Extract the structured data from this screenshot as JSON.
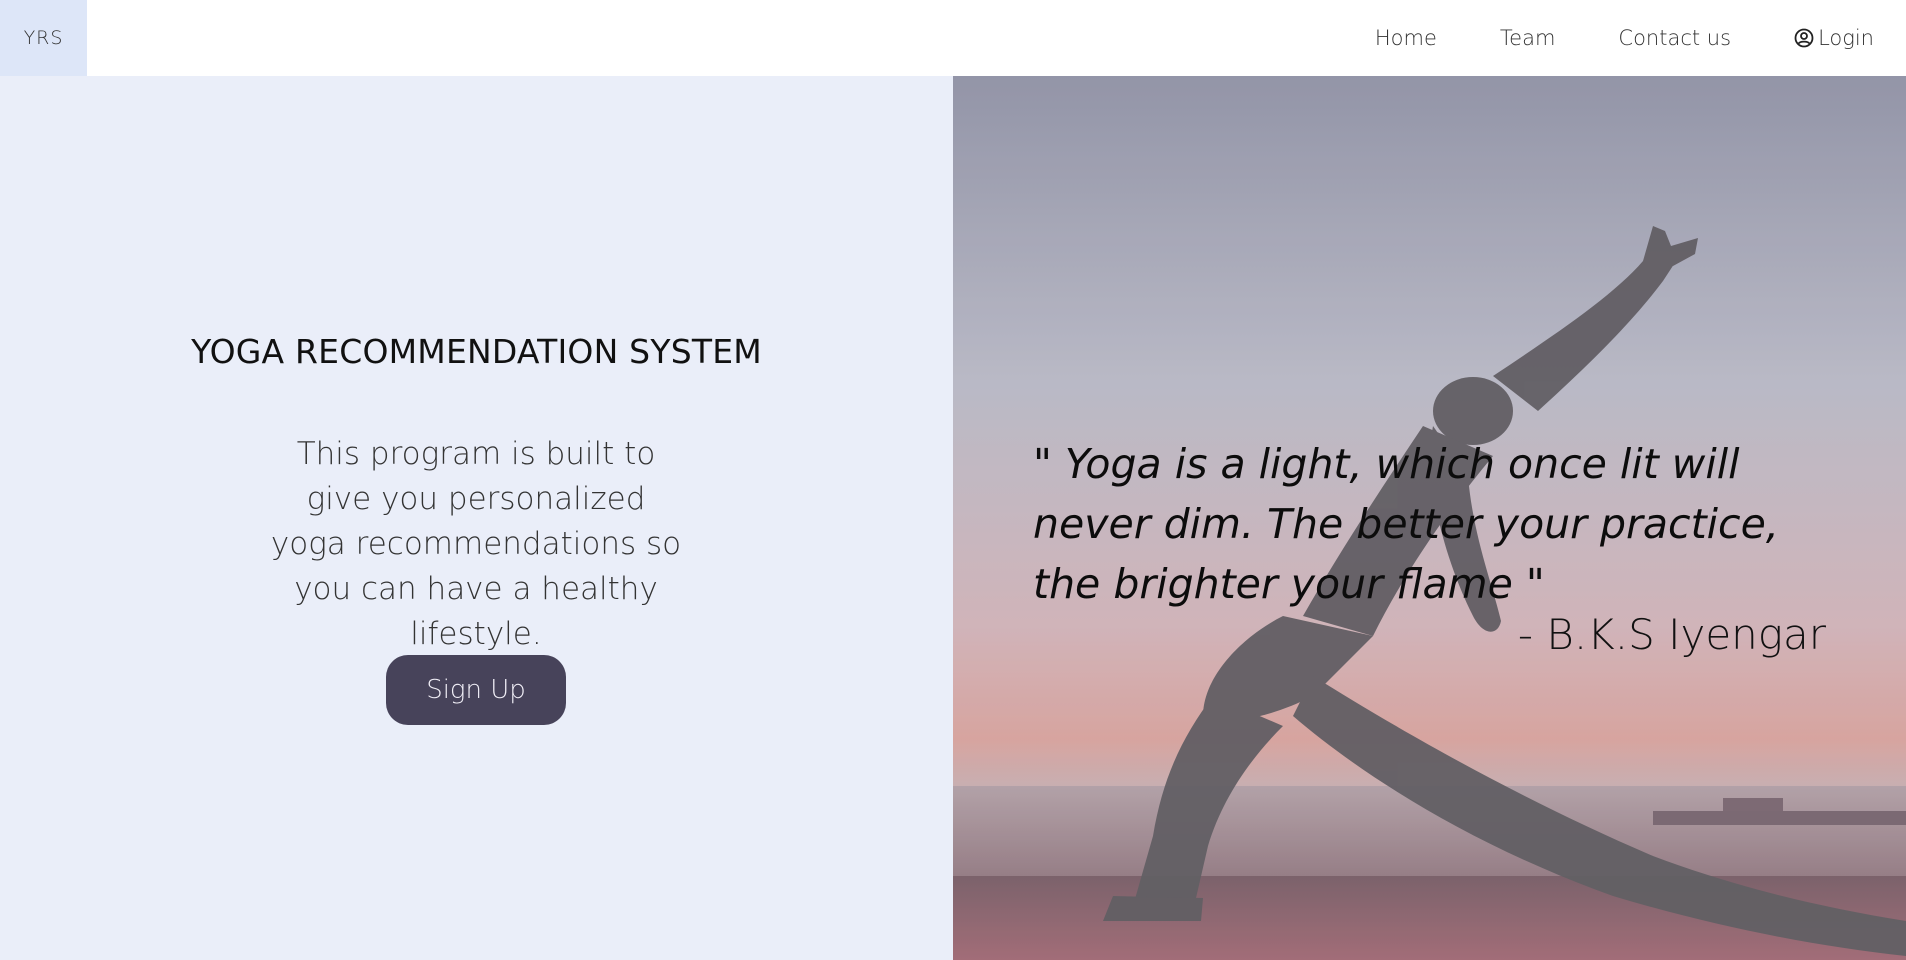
{
  "navbar": {
    "brand": "YRS",
    "links": [
      "Home",
      "Team",
      "Contact us",
      "Login"
    ],
    "login_icon": "user-circle-icon"
  },
  "hero": {
    "title": "YOGA RECOMMENDATION SYSTEM",
    "description": "This program is built to give you personalized yoga recommendations so you can have a healthy lifestyle.",
    "signup_label": "Sign Up"
  },
  "quote": {
    "text": "\" Yoga is a light, which once lit will never dim. The better your practice, the brighter your flame \"",
    "author": "- B.K.S Iyengar"
  },
  "colors": {
    "brand_bg": "#dde6f8",
    "left_bg": "#eaeef9",
    "button_bg": "#47435a"
  }
}
